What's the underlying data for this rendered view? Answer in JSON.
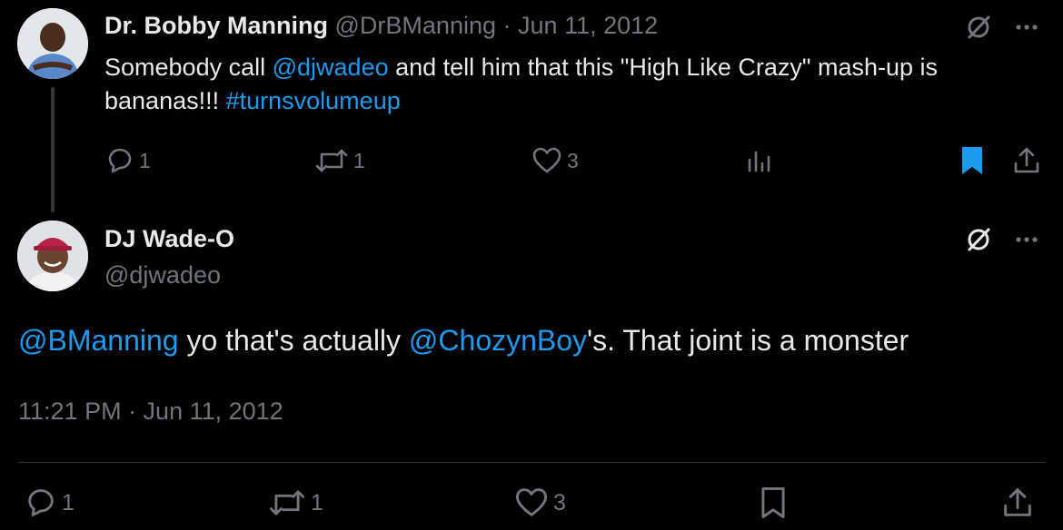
{
  "parent_tweet": {
    "display_name": "Dr. Bobby Manning",
    "handle": "@DrBManning",
    "separator": "·",
    "date": "Jun 11, 2012",
    "text_parts": [
      {
        "text": "Somebody call ",
        "type": "text"
      },
      {
        "text": "@djwadeo",
        "type": "link"
      },
      {
        "text": " and tell him that this \"High Like Crazy\" mash-up is bananas!!! ",
        "type": "text"
      },
      {
        "text": "#turnsvolumeup",
        "type": "link"
      }
    ],
    "actions": {
      "replies": "1",
      "retweets": "1",
      "likes": "3"
    },
    "icons": [
      "grok-icon",
      "more-icon",
      "reply-icon",
      "retweet-icon",
      "like-icon",
      "views-icon",
      "bookmark-filled-icon",
      "share-icon"
    ]
  },
  "reply_tweet": {
    "display_name": "DJ Wade-O",
    "handle": "@djwadeo",
    "text_parts": [
      {
        "text": "@BManning",
        "type": "link"
      },
      {
        "text": " yo that's actually ",
        "type": "text"
      },
      {
        "text": "@ChozynBoy",
        "type": "link"
      },
      {
        "text": "'s. That joint is a monster",
        "type": "text"
      }
    ],
    "timestamp": "11:21 PM · Jun 11, 2012",
    "actions": {
      "replies": "1",
      "retweets": "1",
      "likes": "3"
    }
  },
  "colors": {
    "background": "#000000",
    "text": "#e7e9ea",
    "muted": "#71767b",
    "link": "#1d9bf0",
    "divider": "#2f3336"
  }
}
